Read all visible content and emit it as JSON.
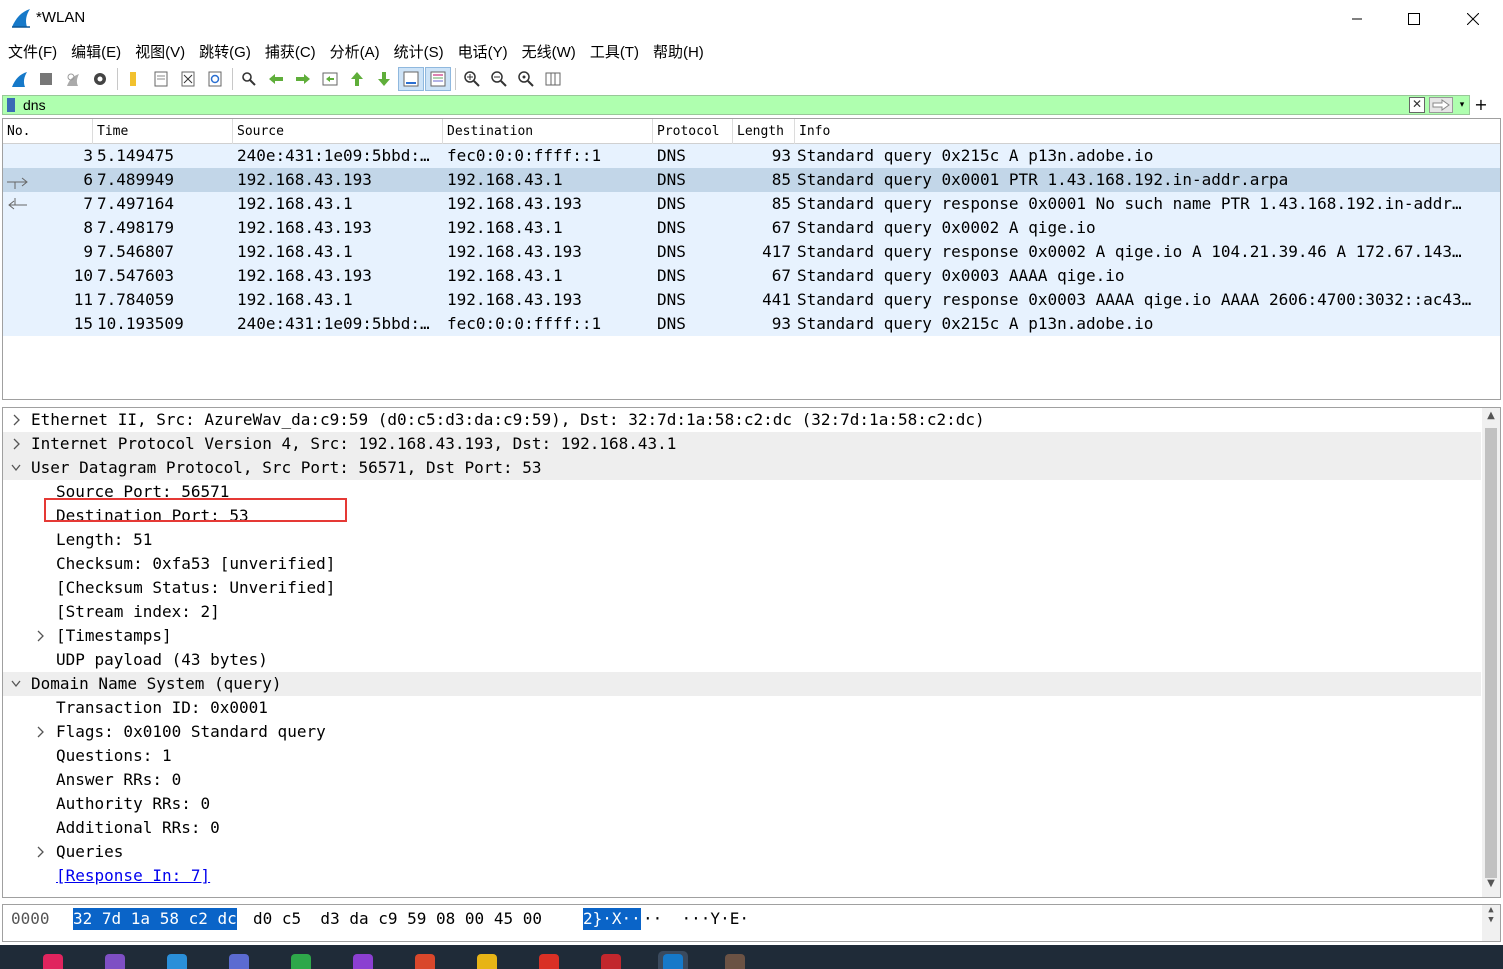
{
  "window": {
    "title": "*WLAN"
  },
  "menu": [
    "文件(F)",
    "编辑(E)",
    "视图(V)",
    "跳转(G)",
    "捕获(C)",
    "分析(A)",
    "统计(S)",
    "电话(Y)",
    "无线(W)",
    "工具(T)",
    "帮助(H)"
  ],
  "toolbar": [
    "shark-start-icon",
    "stop-icon",
    "restart-icon",
    "options-gear-icon",
    "open-file-icon",
    "save-file-icon",
    "close-file-icon",
    "reload-icon",
    "find-packet-icon",
    "go-back-icon",
    "go-forward-icon",
    "go-to-packet-icon",
    "go-first-icon",
    "go-last-icon",
    "autoscroll-icon",
    "colorize-icon",
    "zoom-in-icon",
    "zoom-out-icon",
    "zoom-normal-icon",
    "resize-columns-icon"
  ],
  "filter": {
    "value": "dns"
  },
  "packet_list": {
    "columns": [
      "No.",
      "Time",
      "Source",
      "Destination",
      "Protocol",
      "Length",
      "Info"
    ],
    "rows": [
      {
        "no": "3",
        "time": "5.149475",
        "src": "240e:431:1e09:5bbd:…",
        "dst": "fec0:0:0:ffff::1",
        "proto": "DNS",
        "len": "93",
        "info": "Standard query 0x215c A p13n.adobe.io"
      },
      {
        "no": "6",
        "time": "7.489949",
        "src": "192.168.43.193",
        "dst": "192.168.43.1",
        "proto": "DNS",
        "len": "85",
        "info": "Standard query 0x0001 PTR 1.43.168.192.in-addr.arpa"
      },
      {
        "no": "7",
        "time": "7.497164",
        "src": "192.168.43.1",
        "dst": "192.168.43.193",
        "proto": "DNS",
        "len": "85",
        "info": "Standard query response 0x0001 No such name PTR 1.43.168.192.in-addr…"
      },
      {
        "no": "8",
        "time": "7.498179",
        "src": "192.168.43.193",
        "dst": "192.168.43.1",
        "proto": "DNS",
        "len": "67",
        "info": "Standard query 0x0002 A qige.io"
      },
      {
        "no": "9",
        "time": "7.546807",
        "src": "192.168.43.1",
        "dst": "192.168.43.193",
        "proto": "DNS",
        "len": "417",
        "info": "Standard query response 0x0002 A qige.io A 104.21.39.46 A 172.67.143…"
      },
      {
        "no": "10",
        "time": "7.547603",
        "src": "192.168.43.193",
        "dst": "192.168.43.1",
        "proto": "DNS",
        "len": "67",
        "info": "Standard query 0x0003 AAAA qige.io"
      },
      {
        "no": "11",
        "time": "7.784059",
        "src": "192.168.43.1",
        "dst": "192.168.43.193",
        "proto": "DNS",
        "len": "441",
        "info": "Standard query response 0x0003 AAAA qige.io AAAA 2606:4700:3032::ac43…"
      },
      {
        "no": "15",
        "time": "10.193509",
        "src": "240e:431:1e09:5bbd:…",
        "dst": "fec0:0:0:ffff::1",
        "proto": "DNS",
        "len": "93",
        "info": "Standard query 0x215c A p13n.adobe.io"
      }
    ]
  },
  "details": [
    {
      "text": "Ethernet II, Src: AzureWav_da:c9:59 (d0:c5:d3:da:c9:59), Dst: 32:7d:1a:58:c2:dc (32:7d:1a:58:c2:dc)",
      "indent": 0,
      "expander": ">"
    },
    {
      "text": "Internet Protocol Version 4, Src: 192.168.43.193, Dst: 192.168.43.1",
      "indent": 0,
      "expander": ">"
    },
    {
      "text": "User Datagram Protocol, Src Port: 56571, Dst Port: 53",
      "indent": 0,
      "expander": "v"
    },
    {
      "text": "Source Port: 56571",
      "indent": 1,
      "expander": ""
    },
    {
      "text": "Destination Port: 53",
      "indent": 1,
      "expander": ""
    },
    {
      "text": "Length: 51",
      "indent": 1,
      "expander": ""
    },
    {
      "text": "Checksum: 0xfa53 [unverified]",
      "indent": 1,
      "expander": ""
    },
    {
      "text": "[Checksum Status: Unverified]",
      "indent": 1,
      "expander": ""
    },
    {
      "text": "[Stream index: 2]",
      "indent": 1,
      "expander": ""
    },
    {
      "text": "[Timestamps]",
      "indent": 1,
      "expander": ">"
    },
    {
      "text": "UDP payload (43 bytes)",
      "indent": 1,
      "expander": ""
    },
    {
      "text": "Domain Name System (query)",
      "indent": 0,
      "expander": "v"
    },
    {
      "text": "Transaction ID: 0x0001",
      "indent": 1,
      "expander": ""
    },
    {
      "text": "Flags: 0x0100 Standard query",
      "indent": 1,
      "expander": ">"
    },
    {
      "text": "Questions: 1",
      "indent": 1,
      "expander": ""
    },
    {
      "text": "Answer RRs: 0",
      "indent": 1,
      "expander": ""
    },
    {
      "text": "Authority RRs: 0",
      "indent": 1,
      "expander": ""
    },
    {
      "text": "Additional RRs: 0",
      "indent": 1,
      "expander": ""
    },
    {
      "text": "Queries",
      "indent": 1,
      "expander": ">"
    },
    {
      "text": "[Response In: 7]",
      "indent": 1,
      "expander": ""
    }
  ],
  "bytes": {
    "offset": "0000",
    "selected_hex": "32 7d 1a 58 c2 dc",
    "rest_hex": "d0 c5  d3 da c9 59 08 00 45 00",
    "selected_ascii": "2}·X··",
    "rest_ascii": "··  ···Y·E·"
  },
  "taskbar": [
    "intellij-icon",
    "visual-studio-icon",
    "vscode-icon",
    "dev-icon",
    "pycharm-icon",
    "podcast-icon",
    "typora-icon",
    "chrome-icon",
    "youdao-icon",
    "netease-music-icon",
    "wireshark-icon",
    "avatar-icon"
  ],
  "colors": {
    "row_bg": "#e7f2fe",
    "row_selected": "#c2d6e8",
    "filter_bg": "#afffaf",
    "byte_highlight": "#0a64c8",
    "callout": "#e53935"
  }
}
